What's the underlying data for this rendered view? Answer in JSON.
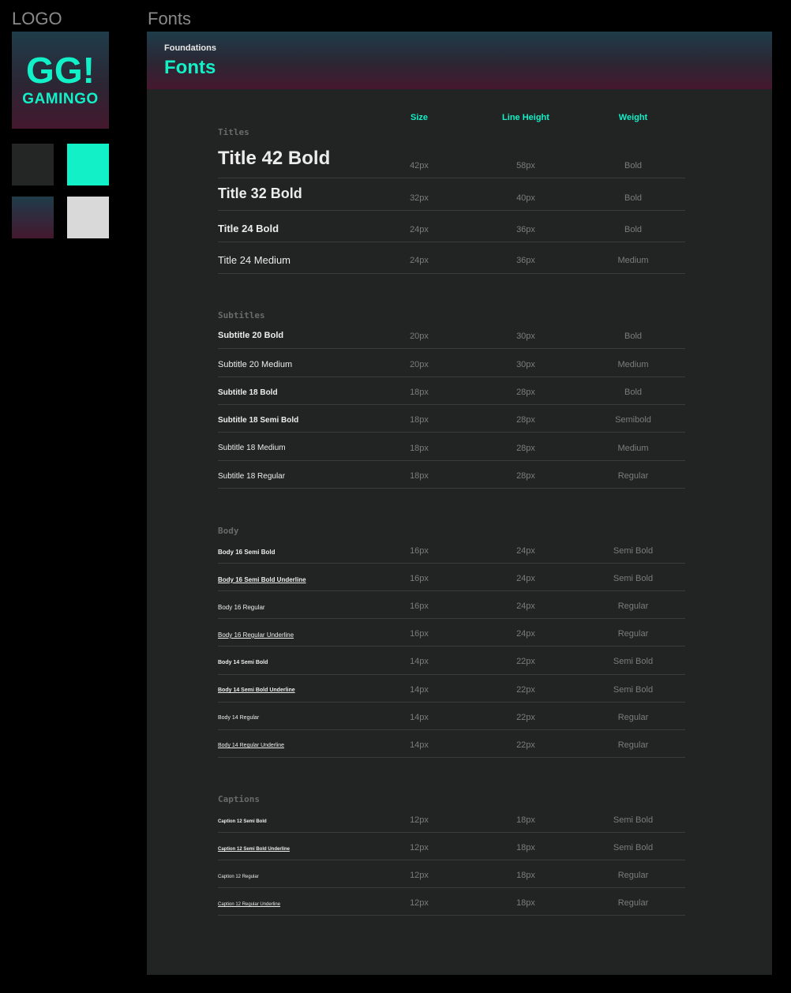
{
  "labels": {
    "logo": "LOGO",
    "fonts": "Fonts"
  },
  "logo": {
    "line1": "GG!",
    "line2": "GAMINGO"
  },
  "swatches": {
    "dark": "#242525",
    "accent": "#12f0c8",
    "gradient": "#1f3c4a-#44182e",
    "light": "#d9d9d9"
  },
  "panel": {
    "breadcrumb": "Foundations",
    "title": "Fonts"
  },
  "columns": {
    "size": "Size",
    "line_height": "Line Height",
    "weight": "Weight"
  },
  "sections": [
    {
      "title": "Titles",
      "rows": [
        {
          "name": "Title 42 Bold",
          "size": "42px",
          "line_height": "58px",
          "weight": "Bold"
        },
        {
          "name": "Title 32 Bold",
          "size": "32px",
          "line_height": "40px",
          "weight": "Bold"
        },
        {
          "name": "Title 24 Bold",
          "size": "24px",
          "line_height": "36px",
          "weight": "Bold"
        },
        {
          "name": "Title 24 Medium",
          "size": "24px",
          "line_height": "36px",
          "weight": "Medium"
        }
      ]
    },
    {
      "title": "Subtitles",
      "rows": [
        {
          "name": "Subtitle 20 Bold",
          "size": "20px",
          "line_height": "30px",
          "weight": "Bold"
        },
        {
          "name": "Subtitle 20 Medium",
          "size": "20px",
          "line_height": "30px",
          "weight": "Medium"
        },
        {
          "name": "Subtitle 18 Bold",
          "size": "18px",
          "line_height": "28px",
          "weight": "Bold"
        },
        {
          "name": "Subtitle 18 Semi Bold",
          "size": "18px",
          "line_height": "28px",
          "weight": "Semibold"
        },
        {
          "name": "Subtitle 18 Medium",
          "size": "18px",
          "line_height": "28px",
          "weight": "Medium"
        },
        {
          "name": "Subtitle 18 Regular",
          "size": "18px",
          "line_height": "28px",
          "weight": "Regular"
        }
      ]
    },
    {
      "title": "Body",
      "rows": [
        {
          "name": "Body 16 Semi Bold",
          "size": "16px",
          "line_height": "24px",
          "weight": "Semi Bold"
        },
        {
          "name": "Body 16 Semi Bold Underline",
          "size": "16px",
          "line_height": "24px",
          "weight": "Semi Bold"
        },
        {
          "name": "Body 16 Regular",
          "size": "16px",
          "line_height": "24px",
          "weight": "Regular"
        },
        {
          "name": "Body 16 Regular Underline",
          "size": "16px",
          "line_height": "24px",
          "weight": "Regular"
        },
        {
          "name": "Body 14 Semi Bold",
          "size": "14px",
          "line_height": "22px",
          "weight": "Semi Bold"
        },
        {
          "name": "Body 14 Semi Bold Underline",
          "size": "14px",
          "line_height": "22px",
          "weight": "Semi Bold"
        },
        {
          "name": "Body 14 Regular",
          "size": "14px",
          "line_height": "22px",
          "weight": "Regular"
        },
        {
          "name": "Body 14 Regular Underline",
          "size": "14px",
          "line_height": "22px",
          "weight": "Regular"
        }
      ]
    },
    {
      "title": "Captions",
      "rows": [
        {
          "name": "Caption 12 Semi Bold",
          "size": "12px",
          "line_height": "18px",
          "weight": "Semi Bold"
        },
        {
          "name": "Caption 12 Semi Bold Underline",
          "size": "12px",
          "line_height": "18px",
          "weight": "Semi Bold"
        },
        {
          "name": "Caption 12 Regular",
          "size": "12px",
          "line_height": "18px",
          "weight": "Regular"
        },
        {
          "name": "Caption 12 Regular Underline",
          "size": "12px",
          "line_height": "18px",
          "weight": "Regular"
        }
      ]
    }
  ]
}
